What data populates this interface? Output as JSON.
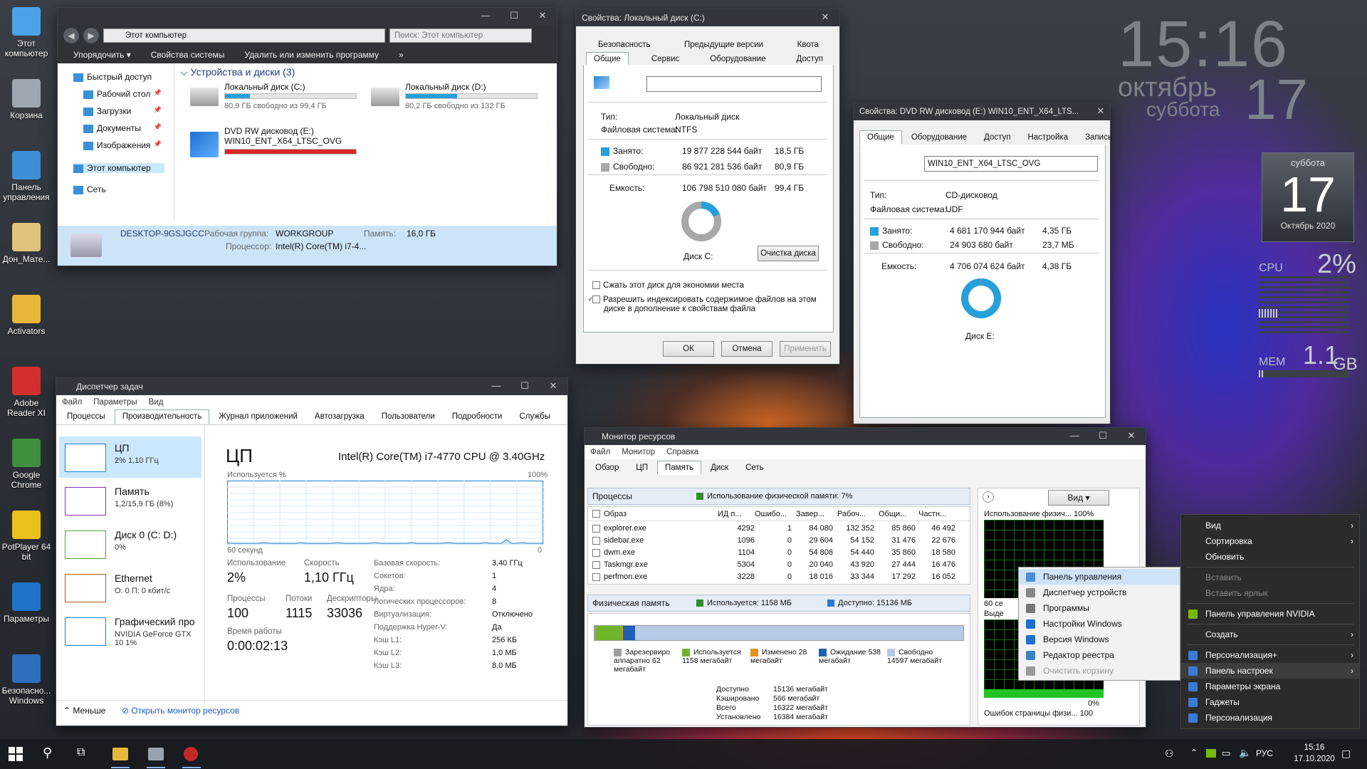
{
  "desktop": {
    "icons": [
      {
        "label": "Этот компьютер",
        "icon": "computer-icon"
      },
      {
        "label": "Корзина",
        "icon": "recycle-bin-icon"
      },
      {
        "label": "Панель управления",
        "icon": "control-panel-icon"
      },
      {
        "label": "Дон_Мате...",
        "icon": "folder-icon"
      },
      {
        "label": "Activators",
        "icon": "key-folder-icon"
      },
      {
        "label": "Adobe Reader XI",
        "icon": "pdf-icon"
      },
      {
        "label": "Google Chrome",
        "icon": "chrome-icon"
      },
      {
        "label": "PotPlayer 64 bit",
        "icon": "player-icon"
      },
      {
        "label": "Параметры",
        "icon": "settings-icon"
      },
      {
        "label": "Безопасно... Windows",
        "icon": "shield-icon"
      }
    ]
  },
  "clock_widget": {
    "time": "15:16",
    "month": "октябрь",
    "day_of_week": "суббота",
    "day": "17"
  },
  "calendar_gadget": {
    "weekday": "суббота",
    "day": "17",
    "month_year": "Октябрь 2020"
  },
  "cpu_gadget": {
    "cpu_label": "CPU",
    "cpu_value": "2%",
    "mem_label": "MEM",
    "mem_value": "1.1",
    "mem_unit": "GB"
  },
  "explorer": {
    "address": "Этот компьютер",
    "search_placeholder": "Поиск: Этот компьютер",
    "toolbar": [
      "Упорядочить ▾",
      "Свойства системы",
      "Удалить или изменить программу",
      "»"
    ],
    "nav": [
      {
        "label": "Быстрый доступ",
        "pin": ""
      },
      {
        "label": "Рабочий стол",
        "pin": "📌"
      },
      {
        "label": "Загрузки",
        "pin": "📌"
      },
      {
        "label": "Документы",
        "pin": "📌"
      },
      {
        "label": "Изображения",
        "pin": "📌"
      },
      {
        "label": "Этот компьютер",
        "pin": ""
      },
      {
        "label": "Сеть",
        "pin": ""
      }
    ],
    "group_title": "Устройства и диски (3)",
    "drives": [
      {
        "name": "Локальный диск (C:)",
        "free": "80,9 ГБ свободно из 99,4 ГБ",
        "used": 0.19,
        "color": "#26a0da"
      },
      {
        "name": "Локальный диск (D:)",
        "free": "80,2 ГБ свободно из 132 ГБ",
        "used": 0.39,
        "color": "#26a0da"
      },
      {
        "name": "DVD RW дисковод (E:)",
        "sub": "WIN10_ENT_X64_LTSC_OVG",
        "used": 1.0,
        "color": "#da2626"
      }
    ],
    "details": {
      "computer": "DESKTOP-9GSJGCC",
      "wg_label": "Рабочая группа:",
      "wg": "WORKGROUP",
      "mem_label": "Память:",
      "mem": "16,0 ГБ",
      "cpu_label": "Процессор:",
      "cpu": "Intel(R) Core(TM) i7-4..."
    }
  },
  "disk_c": {
    "title": "Свойства: Локальный диск (C:)",
    "tabs_top": [
      "Безопасность",
      "Предыдущие версии",
      "Квота"
    ],
    "tabs_bottom": [
      "Общие",
      "Сервис",
      "Оборудование",
      "Доступ"
    ],
    "type_label": "Тип:",
    "type": "Локальный диск",
    "fs_label": "Файловая система:",
    "fs": "NTFS",
    "used_label": "Занято:",
    "used_bytes": "19 877 228 544 байт",
    "used_gb": "18,5 ГБ",
    "free_label": "Свободно:",
    "free_bytes": "86 921 281 536 байт",
    "free_gb": "80,9 ГБ",
    "cap_label": "Емкость:",
    "cap_bytes": "106 798 510 080 байт",
    "cap_gb": "99,4 ГБ",
    "used_fraction": 0.19,
    "disk_label": "Диск C:",
    "cleanup": "Очистка диска",
    "compress": "Сжать этот диск для экономии места",
    "index": "Разрешить индексировать содержимое файлов на этом диске в дополнение к свойствам файла",
    "ok": "ОК",
    "cancel": "Отмена",
    "apply": "Применить"
  },
  "dvd": {
    "title": "Свойства: DVD RW дисковод (E:) WIN10_ENT_X64_LTS...",
    "tabs": [
      "Общие",
      "Оборудование",
      "Доступ",
      "Настройка",
      "Запись"
    ],
    "label_value": "WIN10_ENT_X64_LTSC_OVG",
    "type_label": "Тип:",
    "type": "CD-дисковод",
    "fs_label": "Файловая система:",
    "fs": "UDF",
    "used_label": "Занято:",
    "used_bytes": "4 681 170 944 байт",
    "used_gb": "4,35 ГБ",
    "free_label": "Свободно:",
    "free_bytes": "24 903 680 байт",
    "free_gb": "23,7 МБ",
    "cap_label": "Емкость:",
    "cap_bytes": "4 706 074 624 байт",
    "cap_gb": "4,38 ГБ",
    "used_fraction": 0.995,
    "disk_label": "Диск E:"
  },
  "taskmgr": {
    "title": "Диспетчер задач",
    "menu": [
      "Файл",
      "Параметры",
      "Вид"
    ],
    "tabs": [
      "Процессы",
      "Производительность",
      "Журнал приложений",
      "Автозагрузка",
      "Пользователи",
      "Подробности",
      "Службы"
    ],
    "side": [
      {
        "name": "ЦП",
        "val": "2% 1,10 ГГц",
        "color": "#1a7fd0"
      },
      {
        "name": "Память",
        "val": "1,2/15,9 ГБ (8%)",
        "color": "#8b2fbf"
      },
      {
        "name": "Диск 0 (C: D:)",
        "val": "0%",
        "color": "#4da133"
      },
      {
        "name": "Ethernet",
        "val": "О: 0 П: 0 кбит/с",
        "color": "#a75d17"
      },
      {
        "name": "Графический про",
        "val": "NVIDIA GeForce GTX 10 1%",
        "color": "#1a7fd0"
      }
    ],
    "cpu_title": "ЦП",
    "cpu_model": "Intel(R) Core(TM) i7-4770 CPU @ 3.40GHz",
    "usage_label": "Используется %",
    "pct_max": "100%",
    "time_left": "60 секунд",
    "time_right": "0",
    "stats": {
      "usage_l": "Использование",
      "usage": "2%",
      "speed_l": "Скорость",
      "speed": "1,10 ГГц",
      "proc_l": "Процессы",
      "proc": "100",
      "threads_l": "Потоки",
      "threads": "1115",
      "handles_l": "Дескрипторы",
      "handles": "33036",
      "uptime_l": "Время работы",
      "uptime": "0:00:02:13"
    },
    "specs": [
      [
        "Базовая скорость:",
        "3,40 ГГц"
      ],
      [
        "Сокетов:",
        "1"
      ],
      [
        "Ядра:",
        "4"
      ],
      [
        "Логических процессоров:",
        "8"
      ],
      [
        "Виртуализация:",
        "Отключено"
      ],
      [
        "Поддержка Hyper-V:",
        "Да"
      ],
      [
        "Кэш L1:",
        "256 КБ"
      ],
      [
        "Кэш L2:",
        "1,0 МБ"
      ],
      [
        "Кэш L3:",
        "8,0 МБ"
      ]
    ],
    "less": "Меньше",
    "open_monitor": "Открыть монитор ресурсов"
  },
  "resmon": {
    "title": "Монитор ресурсов",
    "menu": [
      "Файл",
      "Монитор",
      "Справка"
    ],
    "tabs": [
      "Обзор",
      "ЦП",
      "Память",
      "Диск",
      "Сеть"
    ],
    "proc_header": "Процессы",
    "proc_badge": "Использование физической памяти: 7%",
    "cols": [
      "Образ",
      "ИД п...",
      "Ошибо...",
      "Завер...",
      "Рабоч...",
      "Общи...",
      "Частн..."
    ],
    "rows": [
      [
        "explorer.exe",
        "4292",
        "1",
        "84 080",
        "132 352",
        "85 860",
        "46 492"
      ],
      [
        "sidebar.exe",
        "1096",
        "0",
        "29 604",
        "54 152",
        "31 476",
        "22 676"
      ],
      [
        "dwm.exe",
        "1104",
        "0",
        "54 808",
        "54 440",
        "35 860",
        "18 580"
      ],
      [
        "Taskmgr.exe",
        "5304",
        "0",
        "20 040",
        "43 920",
        "27 444",
        "16 476"
      ],
      [
        "perfmon.exe",
        "3228",
        "0",
        "18 016",
        "33 344",
        "17 292",
        "16 052"
      ]
    ],
    "phys_header": "Физическая память",
    "phys_used": "Используется: 1158 МБ",
    "phys_avail": "Доступно: 15136 МБ",
    "legend": [
      {
        "label": "Зарезервиро аппаратно 62 мегабайт",
        "color": "#9e9e9e"
      },
      {
        "label": "Используется 1158 мегабайт",
        "color": "#6fb62c"
      },
      {
        "label": "Изменено 28 мегабайт",
        "color": "#e8901e"
      },
      {
        "label": "Ожидание 538 мегабайт",
        "color": "#1f5fb5"
      },
      {
        "label": "Свободно 14597 мегабайт",
        "color": "#b7cbe8"
      }
    ],
    "summary": [
      [
        "Доступно",
        "15136 мегабайт"
      ],
      [
        "Кэшировано",
        "566 мегабайт"
      ],
      [
        "Всего",
        "16322 мегабайт"
      ],
      [
        "Установлено",
        "16384 мегабайт"
      ]
    ],
    "view_btn": "Вид",
    "graph1": "Использование физич... 100%",
    "graph_60": "60 се",
    "graph_vyd": "Выде",
    "graph_0": "0%",
    "graph2": "Ошибок страницы физи... 100"
  },
  "context_menu": {
    "items": [
      {
        "label": "Вид",
        "arrow": true
      },
      {
        "label": "Сортировка",
        "arrow": true
      },
      {
        "label": "Обновить"
      },
      {
        "sep": true
      },
      {
        "label": "Вставить",
        "dis": true
      },
      {
        "label": "Вставить ярлык",
        "dis": true
      },
      {
        "sep": true
      },
      {
        "label": "Панель управления NVIDIA",
        "icon": "#76b900"
      },
      {
        "sep": true
      },
      {
        "label": "Создать",
        "arrow": true
      },
      {
        "sep": true
      },
      {
        "label": "Персонализация+",
        "arrow": true,
        "icon": "#3a7bd5"
      },
      {
        "label": "Панель настроек",
        "arrow": true,
        "icon": "#3a7bd5",
        "hi": true
      },
      {
        "label": "Параметры экрана",
        "icon": "#3a7bd5"
      },
      {
        "label": "Гаджеты",
        "icon": "#3a7bd5"
      },
      {
        "label": "Персонализация",
        "icon": "#3a7bd5"
      }
    ],
    "sub": [
      {
        "label": "Панель управления",
        "icon": "#4a90d9",
        "hi": true
      },
      {
        "label": "Диспетчер устройств",
        "icon": "#888"
      },
      {
        "label": "Программы",
        "icon": "#777"
      },
      {
        "label": "Настройки Windows",
        "icon": "#1e6fd0"
      },
      {
        "label": "Версия Windows",
        "icon": "#1e6fd0"
      },
      {
        "label": "Редактор реестра",
        "icon": "#3b82c4"
      },
      {
        "label": "Очистить корзину",
        "icon": "#999",
        "dis": true
      }
    ]
  },
  "taskbar": {
    "lang": "РУС",
    "time": "15:16",
    "date": "17.10.2020"
  }
}
